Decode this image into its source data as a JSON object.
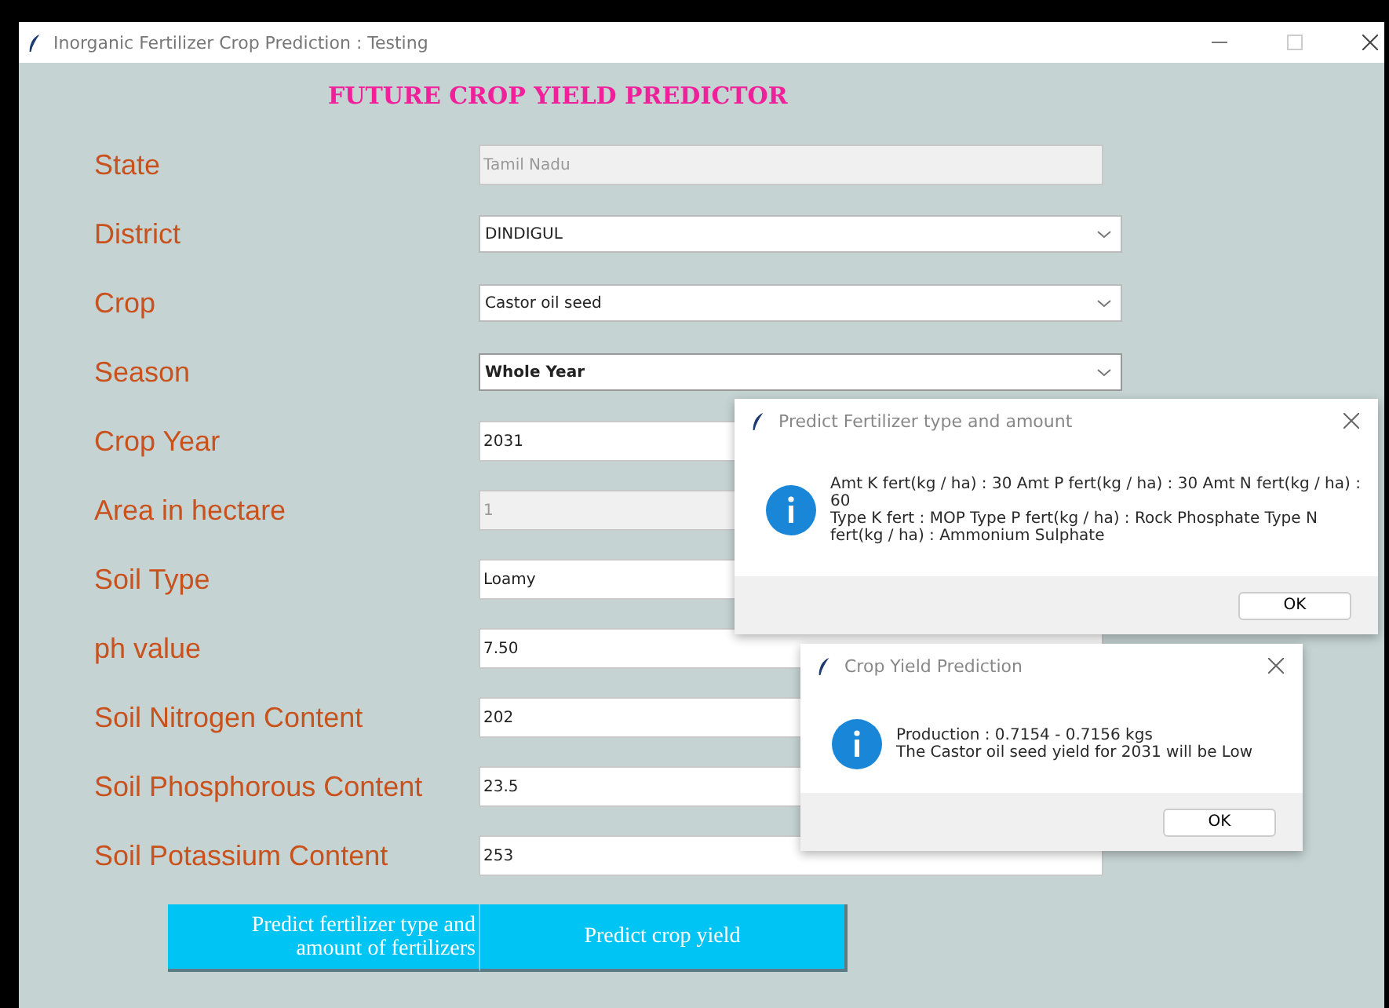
{
  "window": {
    "title": "Inorganic Fertilizer Crop Prediction : Testing"
  },
  "heading": "FUTURE CROP YIELD PREDICTOR",
  "fields": [
    {
      "label": "State",
      "kind": "entry",
      "value": "Tamil Nadu",
      "disabled": true
    },
    {
      "label": "District",
      "kind": "combo",
      "value": "DINDIGUL",
      "focused": false
    },
    {
      "label": "Crop",
      "kind": "combo",
      "value": "Castor oil seed",
      "focused": false
    },
    {
      "label": "Season",
      "kind": "combo",
      "value": "Whole Year",
      "focused": true
    },
    {
      "label": "Crop Year",
      "kind": "entry",
      "value": "2031",
      "disabled": false
    },
    {
      "label": "Area in hectare",
      "kind": "entry",
      "value": "1",
      "disabled": true
    },
    {
      "label": "Soil Type",
      "kind": "entry",
      "value": "Loamy",
      "disabled": false
    },
    {
      "label": "ph value",
      "kind": "entry",
      "value": "7.50",
      "disabled": false
    },
    {
      "label": "Soil Nitrogen Content",
      "kind": "entry",
      "value": "202",
      "disabled": false
    },
    {
      "label": "Soil Phosphorous Content",
      "kind": "entry",
      "value": "23.5",
      "disabled": false
    },
    {
      "label": "Soil Potassium Content",
      "kind": "entry",
      "value": "253",
      "disabled": false
    }
  ],
  "buttons": [
    {
      "lines": [
        "Predict fertilizer type and",
        "amount of fertilizers"
      ]
    },
    {
      "lines": [
        "Predict crop yield"
      ]
    }
  ],
  "dialogs": [
    {
      "title": "Predict Fertilizer type and amount",
      "lines": [
        "Amt K fert(kg / ha) : 30 Amt P fert(kg / ha) : 30 Amt N fert(kg / ha) : 60",
        "Type K fert : MOP Type P fert(kg / ha) : Rock Phosphate Type N fert(kg / ha) : Ammonium Sulphate"
      ],
      "button": "OK"
    },
    {
      "title": "Crop Yield Prediction",
      "lines": [
        "Production : 0.7154 - 0.7156 kgs",
        "The Castor oil seed yield for 2031 will be Low"
      ],
      "button": "OK"
    }
  ]
}
